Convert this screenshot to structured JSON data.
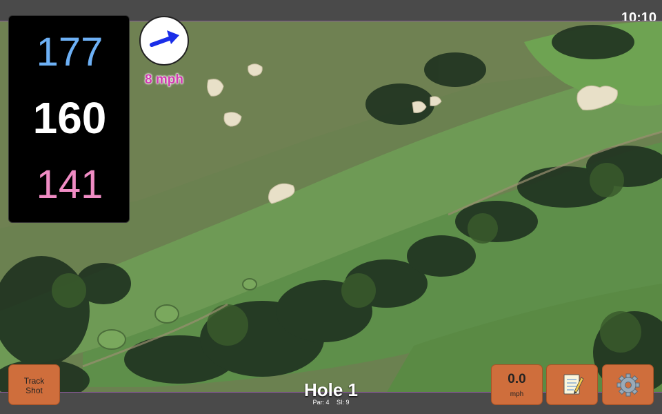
{
  "status": {
    "time": "10:10"
  },
  "yardages": {
    "back": "177",
    "center": "160",
    "front": "141"
  },
  "wind": {
    "speed_label": "8 mph",
    "direction_icon": "arrow-northeast-icon",
    "arrow_color": "#1a2ee8"
  },
  "hole": {
    "title": "Hole 1",
    "par_label": "Par: 4",
    "si_label": "SI: 9"
  },
  "buttons": {
    "track_shot": "Track\nShot",
    "speed_value": "0.0",
    "speed_unit": "mph",
    "notes_icon": "notepad-icon",
    "settings_icon": "gear-icon"
  },
  "colors": {
    "back_yardage": "#6db0f5",
    "center_yardage": "#ffffff",
    "front_yardage": "#f08cc4",
    "button": "#cf6e3c",
    "wind_label": "#d23bb0"
  }
}
